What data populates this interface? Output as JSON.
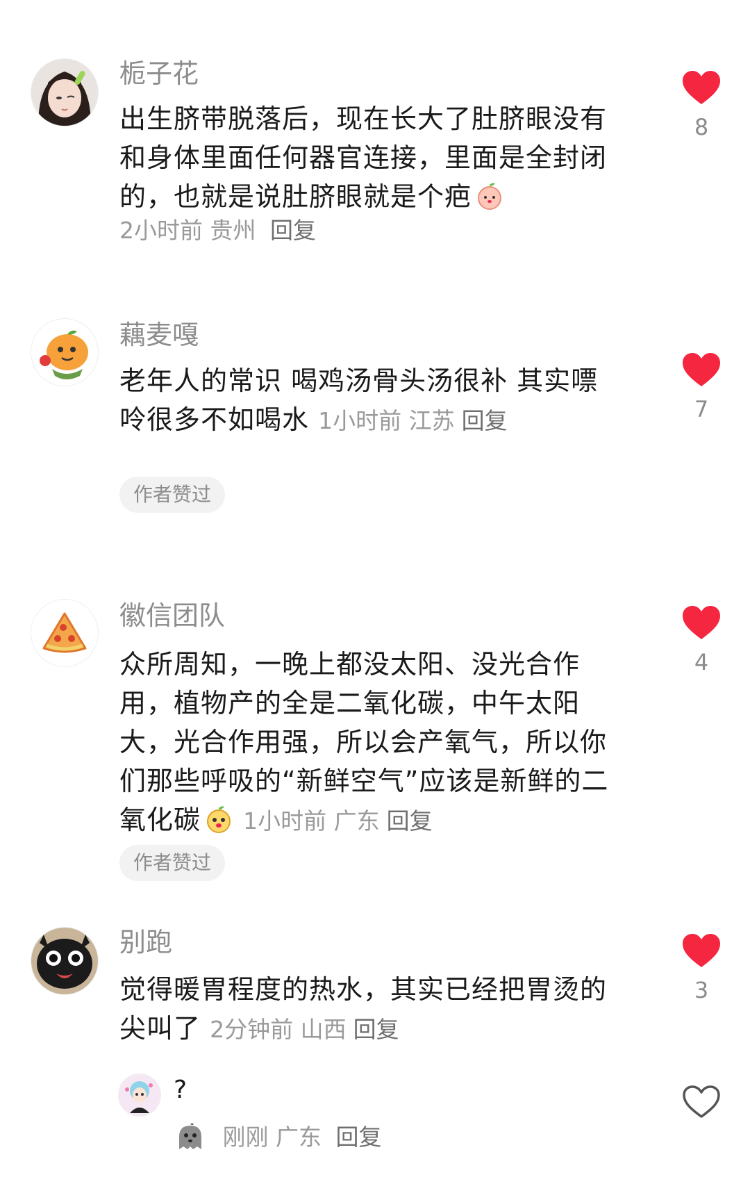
{
  "comments": [
    {
      "username": "栀子花",
      "text": "出生脐带脱落后，现在长大了肚脐眼没有和身体里面任何器官连接，里面是全封闭的，也就是说肚脐眼就是个疤",
      "time": "2小时前",
      "location": "贵州",
      "reply_label": "回复",
      "likes": "8",
      "liked": true
    },
    {
      "username": "藕麦嘎",
      "text": "老年人的常识 喝鸡汤骨头汤很补 其实嘌呤很多不如喝水",
      "time": "1小时前",
      "location": "江苏",
      "reply_label": "回复",
      "badge": "作者赞过",
      "likes": "7",
      "liked": true
    },
    {
      "username": "徽信团队",
      "text": "众所周知，一晚上都没太阳、没光合作用，植物产的全是二氧化碳，中午太阳大，光合作用强，所以会产氧气，所以你们那些呼吸的“新鲜空气”应该是新鲜的二氧化碳",
      "time": "1小时前",
      "location": "广东",
      "reply_label": "回复",
      "badge": "作者赞过",
      "likes": "4",
      "liked": true
    },
    {
      "username": "别跑",
      "text": "觉得暖胃程度的热水，其实已经把胃烫的尖叫了",
      "time": "2分钟前",
      "location": "山西",
      "reply_label": "回复",
      "likes": "3",
      "liked": true
    }
  ],
  "reply": {
    "text": "?",
    "time": "刚刚",
    "location": "广东",
    "reply_label": "回复",
    "liked": false
  },
  "colors": {
    "heart": "#f5263f",
    "meta": "#9a9a9a",
    "username": "#8c8c8c"
  }
}
